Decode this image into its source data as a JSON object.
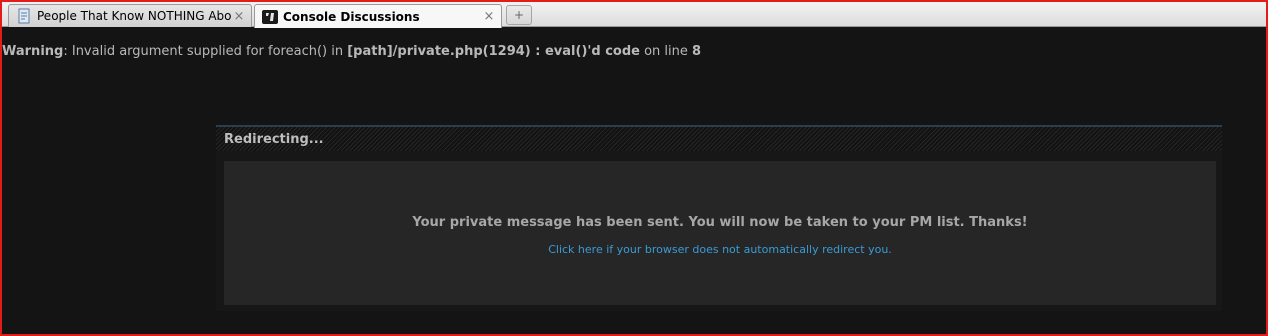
{
  "tabs": [
    {
      "label": "People That Know NOTHING About...",
      "icon": "document-icon",
      "active": false
    },
    {
      "label": "Console Discussions",
      "icon": "site-logo-icon",
      "active": true
    }
  ],
  "new_tab_symbol": "+",
  "close_symbol": "×",
  "warning": {
    "prefix": "Warning",
    "text1": ": Invalid argument supplied for foreach() in ",
    "path": "[path]/private.php(1294) : eval()'d code",
    "text2": " on line ",
    "line": "8"
  },
  "redirect": {
    "title": "Redirecting...",
    "message": "Your private message has been sent. You will now be taken to your PM list. Thanks!",
    "link": "Click here if your browser does not automatically redirect you."
  },
  "colors": {
    "frame": "#e31b1b",
    "background": "#141414",
    "link": "#3a9bd5"
  }
}
